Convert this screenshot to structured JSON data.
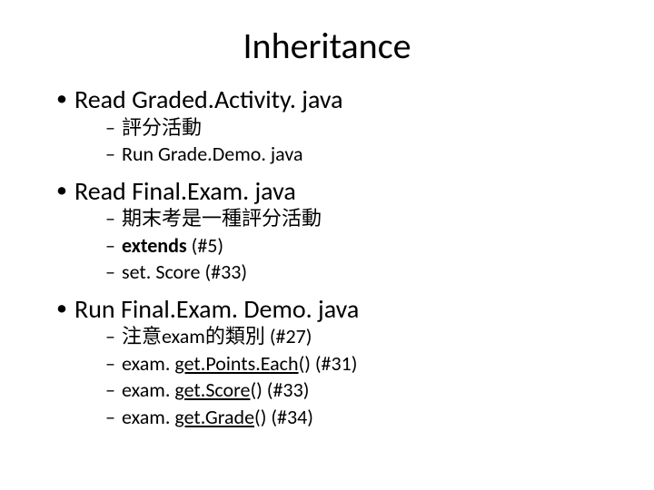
{
  "title": "Inheritance",
  "bullets": [
    {
      "text": "Read Graded.Activity. java",
      "subs": [
        {
          "text": "評分活動"
        },
        {
          "text": "Run Grade.Demo. java"
        }
      ]
    },
    {
      "text": "Read Final.Exam. java",
      "subs": [
        {
          "text": "期末考是一種評分活動"
        },
        {
          "seg": [
            {
              "t": "extends",
              "bold": true
            },
            {
              "t": " (#5)"
            }
          ]
        },
        {
          "text": "set. Score (#33)"
        }
      ]
    },
    {
      "text": "Run Final.Exam. Demo. java",
      "subs": [
        {
          "text": "注意exam的類別 (#27)"
        },
        {
          "seg": [
            {
              "t": "exam. "
            },
            {
              "t": "get.Points.Each",
              "under": true
            },
            {
              "t": "() (#31)"
            }
          ]
        },
        {
          "seg": [
            {
              "t": "exam. "
            },
            {
              "t": "get.Score",
              "under": true
            },
            {
              "t": "()  (#33)"
            }
          ]
        },
        {
          "seg": [
            {
              "t": "exam. "
            },
            {
              "t": "get.Grade",
              "under": true
            },
            {
              "t": "() (#34)"
            }
          ]
        }
      ]
    }
  ]
}
